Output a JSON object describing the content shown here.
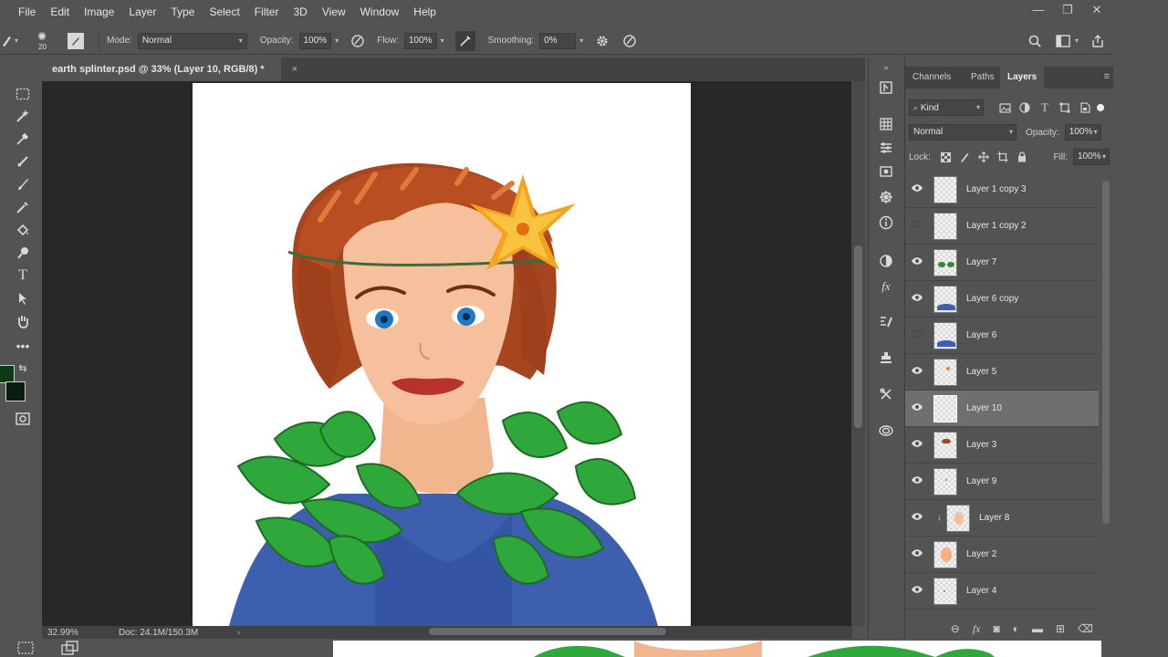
{
  "menu": {
    "items": [
      "File",
      "Edit",
      "Image",
      "Layer",
      "Type",
      "Select",
      "Filter",
      "3D",
      "View",
      "Window",
      "Help"
    ],
    "window_controls": [
      "—",
      "❐",
      "✕"
    ]
  },
  "options": {
    "brush_size": "20",
    "mode_label": "Mode:",
    "mode_value": "Normal",
    "opacity_label": "Opacity:",
    "opacity_value": "100%",
    "flow_label": "Flow:",
    "flow_value": "100%",
    "smoothing_label": "Smoothing:",
    "smoothing_value": "0%"
  },
  "document": {
    "tab_title": "earth splinter.psd @ 33% (Layer 10, RGB/8) *",
    "close": "×",
    "zoom": "32.99%",
    "doc_info": "Doc: 24.1M/150.3M",
    "arrow": "›"
  },
  "colors": {
    "foreground": "#0c3b14",
    "background": "#0b1d10",
    "ui_bg": "#535353",
    "selected_layer": "#6f6f6f"
  },
  "panel": {
    "tabs": [
      "Channels",
      "Paths",
      "Layers"
    ],
    "active_tab": "Layers",
    "filter_label": "Kind",
    "blend_mode": "Normal",
    "opacity_label": "Opacity:",
    "opacity_value": "100%",
    "lock_label": "Lock:",
    "fill_label": "Fill:",
    "fill_value": "100%",
    "layers": [
      {
        "name": "Layer 1 copy 3",
        "visible": true,
        "selected": false
      },
      {
        "name": "Layer 1 copy 2",
        "visible": false,
        "selected": false
      },
      {
        "name": "Layer 7",
        "visible": true,
        "selected": false
      },
      {
        "name": "Layer 6 copy",
        "visible": true,
        "selected": false
      },
      {
        "name": "Layer 6",
        "visible": false,
        "selected": false
      },
      {
        "name": "Layer 5",
        "visible": true,
        "selected": false
      },
      {
        "name": "Layer 10",
        "visible": true,
        "selected": true
      },
      {
        "name": "Layer 3",
        "visible": true,
        "selected": false
      },
      {
        "name": "Layer 9",
        "visible": true,
        "selected": false
      },
      {
        "name": "Layer 8",
        "visible": true,
        "selected": false,
        "clipped": true
      },
      {
        "name": "Layer 2",
        "visible": true,
        "selected": false
      },
      {
        "name": "Layer 4",
        "visible": true,
        "selected": false
      }
    ]
  }
}
